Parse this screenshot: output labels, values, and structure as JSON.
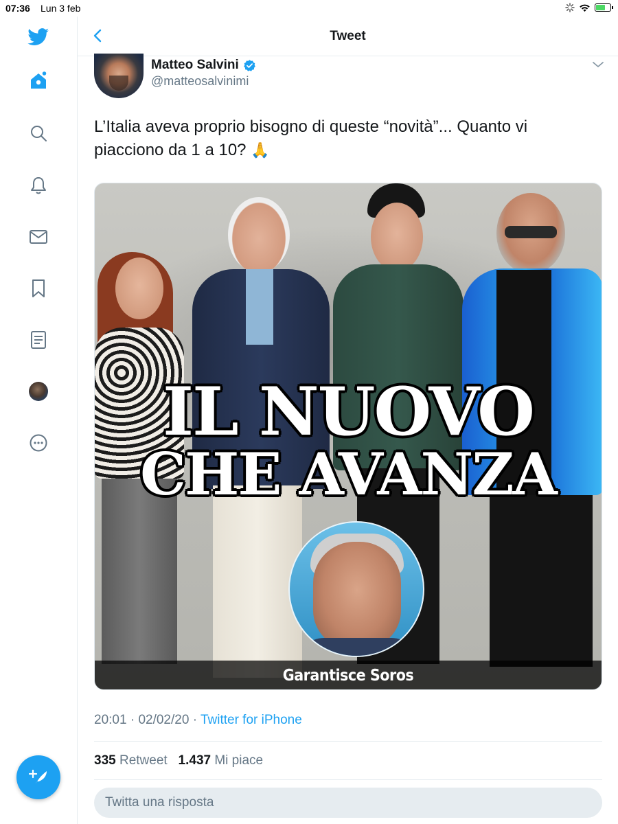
{
  "status_bar": {
    "time": "07:36",
    "date": "Lun 3 feb"
  },
  "sidebar": {
    "items": [
      {
        "icon": "twitter-logo-icon"
      },
      {
        "icon": "home-icon"
      },
      {
        "icon": "search-icon"
      },
      {
        "icon": "notifications-icon"
      },
      {
        "icon": "messages-icon"
      },
      {
        "icon": "bookmarks-icon"
      },
      {
        "icon": "lists-icon"
      },
      {
        "icon": "profile-avatar-icon"
      },
      {
        "icon": "more-icon"
      }
    ],
    "compose_icon": "compose-tweet-icon"
  },
  "header": {
    "title": "Tweet"
  },
  "tweet": {
    "author_name": "Matteo Salvini",
    "author_handle": "@matteosalvinimi",
    "text_line1": "L’Italia aveva proprio bisogno di queste “novità”... Quanto vi",
    "text_line2": "piacciono da 1 a 10?",
    "emoji": "🙏",
    "image": {
      "headline_line1": "IL NUOVO",
      "headline_line2": "CHE AVANZA",
      "caption": "Garantisce Soros"
    },
    "time": "20:01",
    "date": "02/02/20",
    "separator": "·",
    "source": "Twitter for iPhone",
    "retweets_count": "335",
    "retweets_label": "Retweet",
    "likes_count": "1.437",
    "likes_label": "Mi piace"
  },
  "reply": {
    "placeholder": "Twitta una risposta"
  },
  "colors": {
    "accent": "#1da1f2",
    "text": "#14171a",
    "secondary": "#657786",
    "border": "#e6ecf0"
  }
}
